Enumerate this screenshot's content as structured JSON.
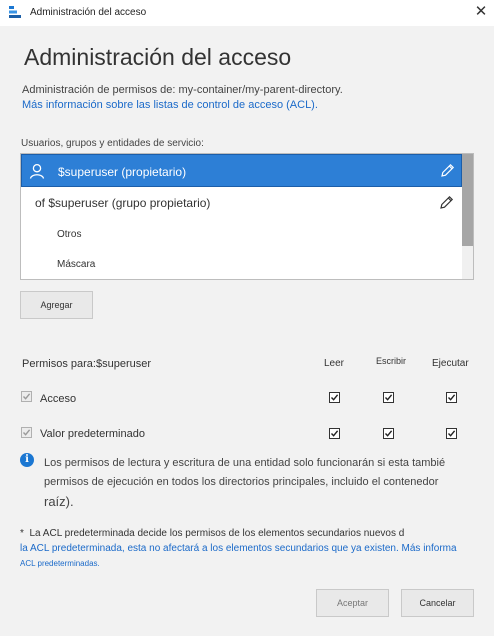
{
  "window": {
    "title": "Administración del acceso",
    "close_glyph": "✕",
    "app_icon": "storage-explorer-icon"
  },
  "header": {
    "title": "Administración del acceso",
    "permissions_of_label": "Administración de permisos de: my-container/my-parent-directory.",
    "acl_link": "Más información sobre las listas de control de acceso (ACL)."
  },
  "principals": {
    "label": "Usuarios, grupos y entidades de servicio:",
    "items": [
      {
        "label": "$superuser (propietario)",
        "selected": true,
        "icon": "user-icon"
      },
      {
        "label": "of $superuser (grupo propietario)",
        "selected": false
      },
      {
        "label": "Otros",
        "selected": false
      },
      {
        "label": "Máscara",
        "selected": false
      }
    ],
    "add_button": "Agregar"
  },
  "permissions": {
    "header": "Permisos para:$superuser",
    "columns": [
      "Leer",
      "Escribir",
      "Ejecutar"
    ],
    "rows": [
      {
        "label": "Acceso",
        "enabled": true,
        "read": true,
        "write": true,
        "execute": true
      },
      {
        "label": "Valor predeterminado",
        "enabled": true,
        "read": true,
        "write": true,
        "execute": true
      }
    ]
  },
  "info": {
    "lines": [
      "Los permisos de lectura y escritura de una entidad solo funcionarán si esta tambié",
      "permisos de ejecución en todos los directorios principales, incluido el contenedor",
      "raíz)."
    ]
  },
  "note": {
    "line1": "La ACL predeterminada decide los permisos de los elementos secundarios nuevos d",
    "line2": "la ACL predeterminada, esta no afectará a los elementos secundarios que ya existen. Más informa",
    "line3": "ACL predeterminadas."
  },
  "footer": {
    "ok_button": "Aceptar",
    "cancel_button": "Cancelar"
  },
  "colors": {
    "accent": "#2d7fd6",
    "link": "#1b6ac9",
    "info": "#1b77d2"
  }
}
